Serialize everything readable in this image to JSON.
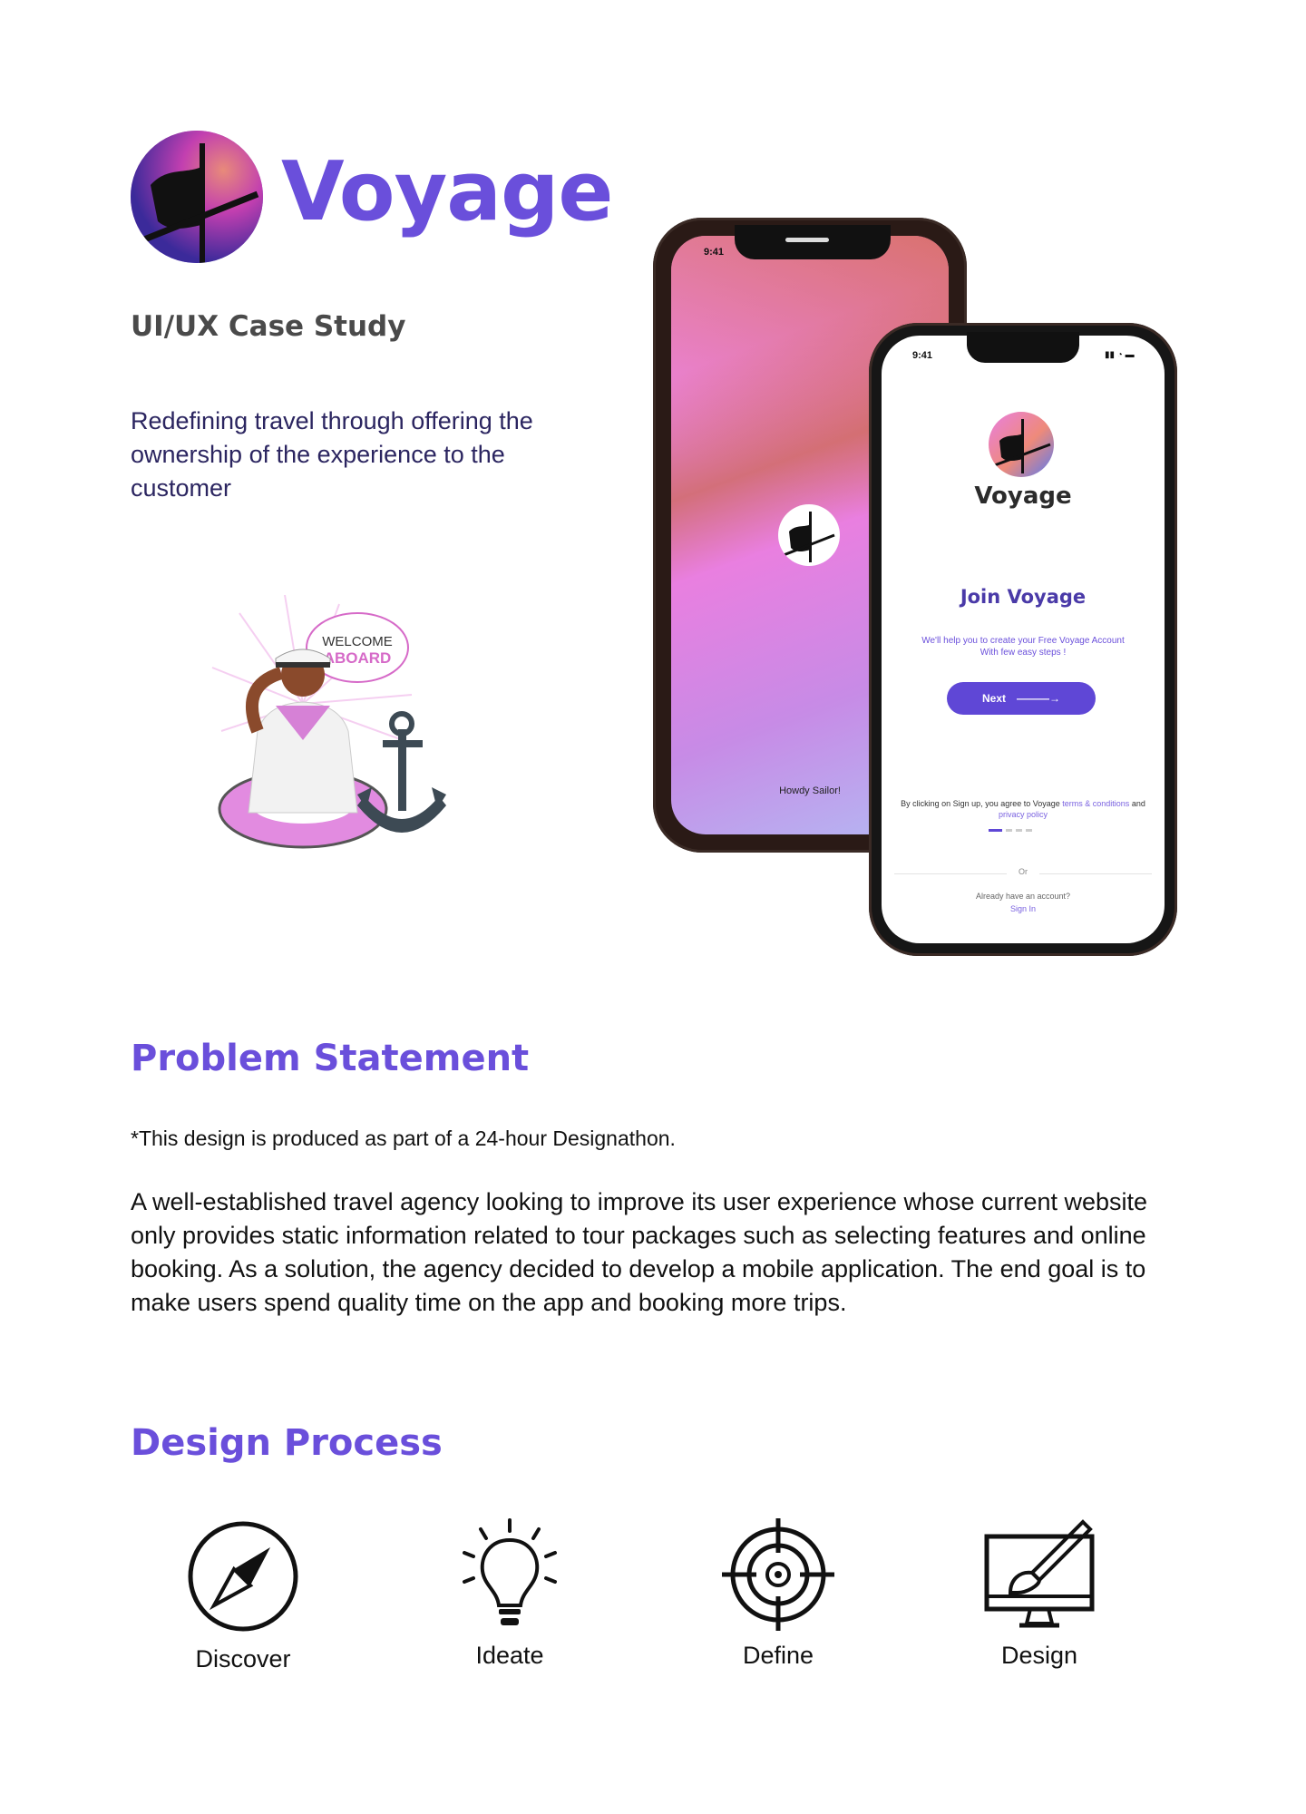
{
  "header": {
    "brand": "Voyage",
    "subtitle": "UI/UX Case Study",
    "tagline": "Redefining travel through offering the ownership of the experience to the customer"
  },
  "illustration": {
    "speech_line1": "WELCOME",
    "speech_line2": "ABOARD"
  },
  "phone_splash": {
    "time": "9:41",
    "greeting": "Howdy Sailor!"
  },
  "phone_signup": {
    "time": "9:41",
    "app_name": "Voyage",
    "heading": "Join Voyage",
    "help_text": "We'll  help you to create your Free Voyage Account With few easy steps !",
    "next_label": "Next",
    "terms_prefix": "By clicking on Sign up, you agree to Voyage",
    "terms_link": "terms & conditions",
    "terms_and": "and",
    "privacy_link": "privacy policy",
    "or_label": "Or",
    "already_text": "Already have an account?",
    "sign_in": "Sign In"
  },
  "problem": {
    "heading": "Problem Statement",
    "note": "*This design is produced as part of a 24-hour Designathon.",
    "body": "A well-established travel agency looking to improve its user experience whose current website only provides static information related to tour packages such as selecting features and online booking. As a solution, the agency decided to develop a mobile application. The end goal is to make users spend quality time on the app and booking more trips."
  },
  "process": {
    "heading": "Design Process",
    "steps": [
      {
        "label": "Discover",
        "icon": "compass-icon"
      },
      {
        "label": "Ideate",
        "icon": "lightbulb-icon"
      },
      {
        "label": "Define",
        "icon": "target-icon"
      },
      {
        "label": "Design",
        "icon": "monitor-brush-icon"
      }
    ]
  },
  "colors": {
    "brand_purple": "#6a4fdb",
    "tagline_navy": "#2b2560",
    "button_purple": "#5f47d6"
  }
}
